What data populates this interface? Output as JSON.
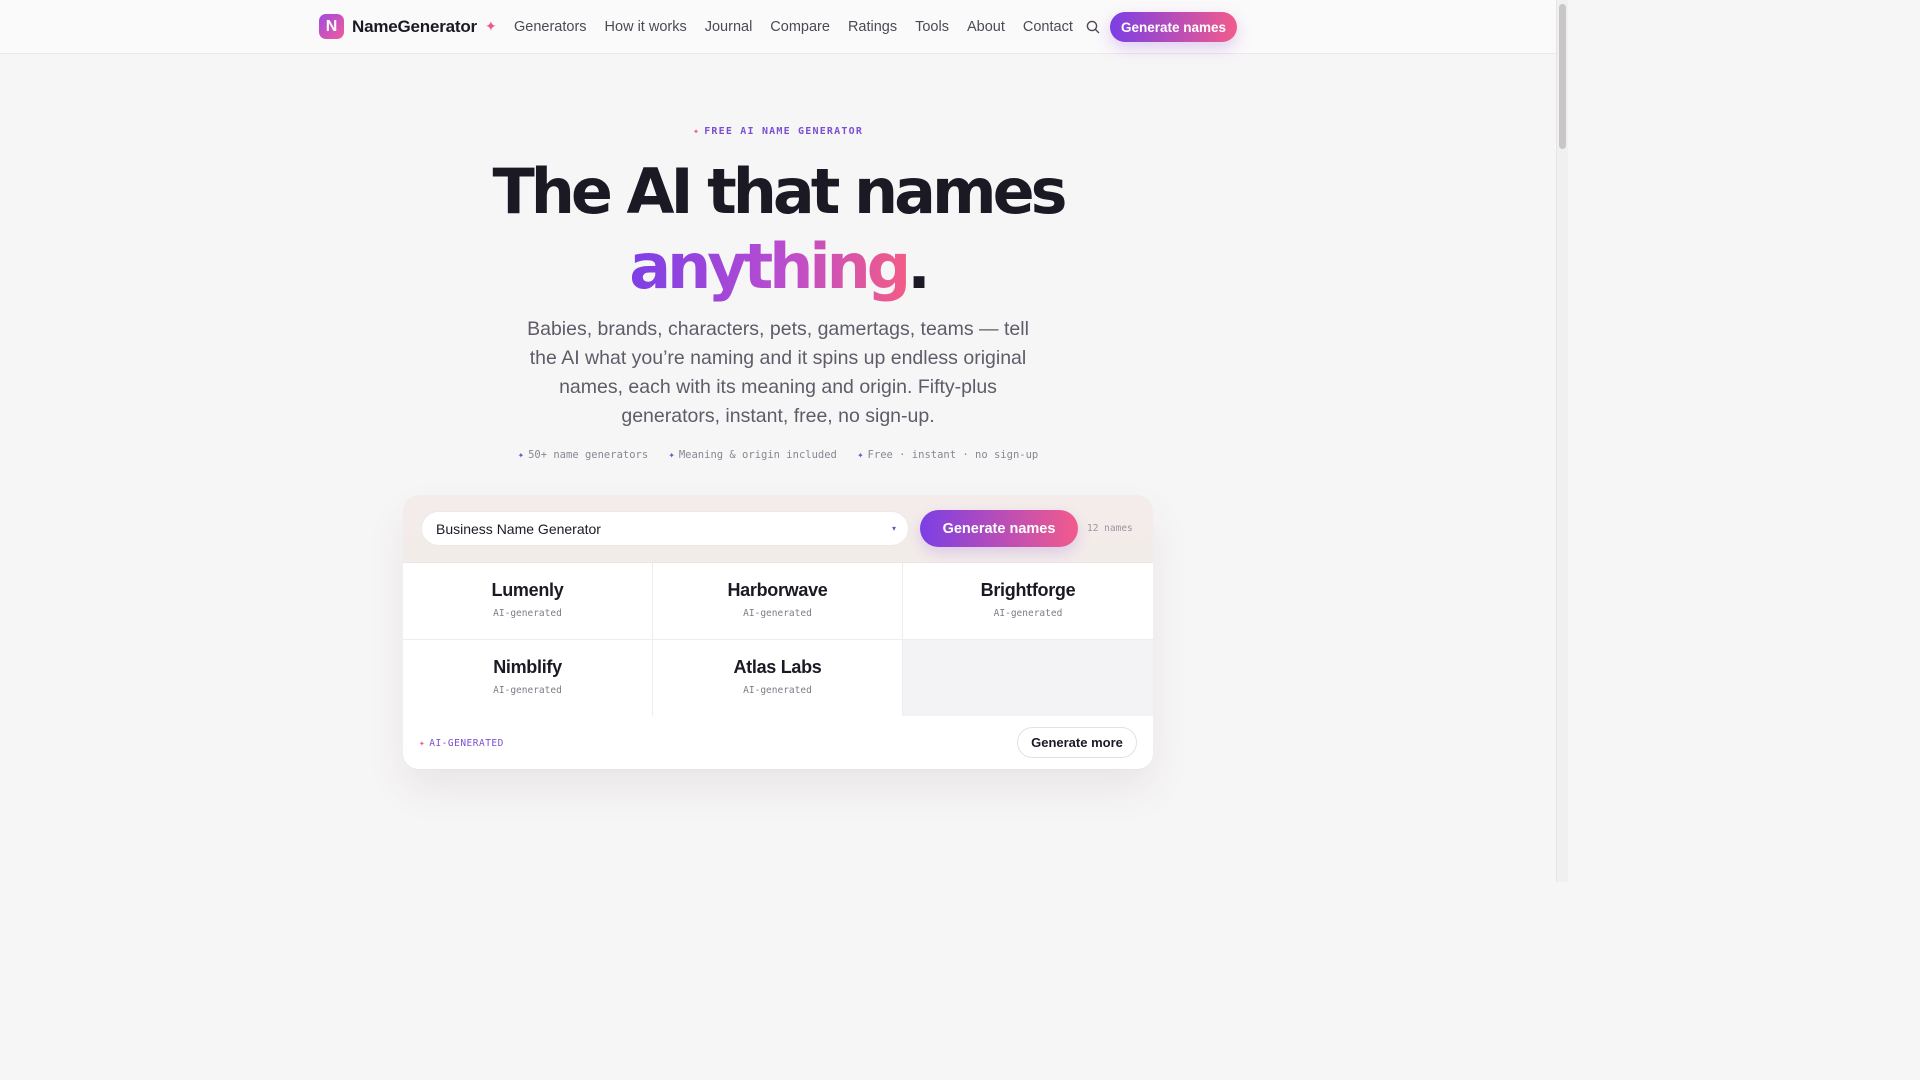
{
  "nav": {
    "brand_letter": "N",
    "brand_name": "NameGenerator",
    "brand_spark": "✦",
    "links": [
      "Generators",
      "How it works",
      "Journal",
      "Compare",
      "Ratings",
      "Tools",
      "About",
      "Contact"
    ],
    "search_icon": "search-icon",
    "cta_label": "Generate names"
  },
  "hero": {
    "eyebrow_spark": "✦",
    "eyebrow": "FREE AI NAME GENERATOR",
    "headline_line1": "The AI that names",
    "headline_word": "anything",
    "headline_period": ".",
    "subheadline": "Babies, brands, characters, pets, gamertags, teams — tell the AI what you’re naming and it spins up endless original names, each with its meaning and origin. Fifty-plus generators, instant, free, no sign-up.",
    "features": [
      "50+ name generators",
      "Meaning & origin included",
      "Free · instant · no sign-up"
    ],
    "feature_spark": "✦"
  },
  "generator": {
    "selected": "Business Name Generator",
    "caret": "▾",
    "button_label": "Generate names",
    "count_label": "12 names",
    "results": [
      {
        "name": "Lumenly",
        "tag": "AI-generated"
      },
      {
        "name": "Harborwave",
        "tag": "AI-generated"
      },
      {
        "name": "Brightforge",
        "tag": "AI-generated"
      },
      {
        "name": "Nimblify",
        "tag": "AI-generated"
      },
      {
        "name": "Atlas Labs",
        "tag": "AI-generated"
      }
    ],
    "footer_spark": "✦",
    "footer_label": "AI-GENERATED",
    "more_label": "Generate more"
  },
  "colors": {
    "accent_purple": "#7b3fe4",
    "accent_pink": "#f25b8c",
    "text_dark": "#1b1a24",
    "background": "#f7f6f6"
  }
}
